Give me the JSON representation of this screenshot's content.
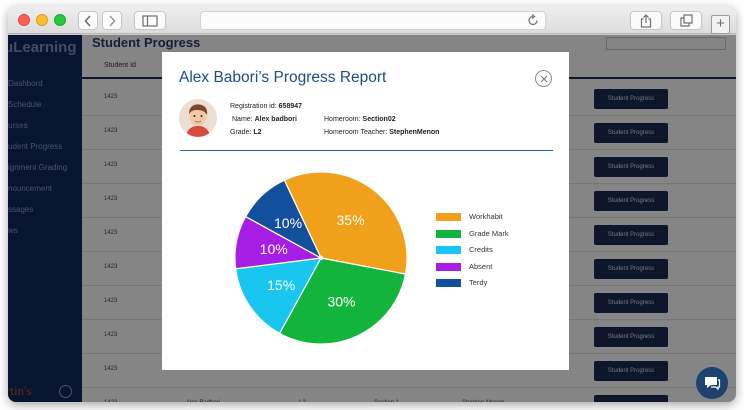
{
  "browser": {
    "nav_back": "back",
    "nav_forward": "forward"
  },
  "app": {
    "brand": "uLearning",
    "page_title": "Student Progress",
    "sidebar": {
      "items": [
        "Dashbord",
        "Schedule",
        "urses",
        "udent Progress",
        "ignment Grading",
        "nouncement",
        "ssages",
        "ws"
      ],
      "footer_logo": "rtin's"
    },
    "table": {
      "columns": [
        "Student Id"
      ],
      "rows": [
        {
          "id": "1423",
          "name": "",
          "grade": "",
          "section": "",
          "teacher": "",
          "action": "Student Progress"
        },
        {
          "id": "1423",
          "name": "",
          "grade": "",
          "section": "",
          "teacher": "",
          "action": "Student Progress"
        },
        {
          "id": "1423",
          "name": "",
          "grade": "",
          "section": "",
          "teacher": "",
          "action": "Student Progress"
        },
        {
          "id": "1423",
          "name": "",
          "grade": "",
          "section": "",
          "teacher": "",
          "action": "Student Progress"
        },
        {
          "id": "1423",
          "name": "",
          "grade": "",
          "section": "",
          "teacher": "",
          "action": "Student Progress"
        },
        {
          "id": "1423",
          "name": "",
          "grade": "",
          "section": "",
          "teacher": "",
          "action": "Student Progress"
        },
        {
          "id": "1423",
          "name": "",
          "grade": "",
          "section": "",
          "teacher": "",
          "action": "Student Progress"
        },
        {
          "id": "1423",
          "name": "",
          "grade": "",
          "section": "",
          "teacher": "",
          "action": "Student Progress"
        },
        {
          "id": "1423",
          "name": "",
          "grade": "",
          "section": "",
          "teacher": "",
          "action": "Student Progress"
        },
        {
          "id": "1423",
          "name": "Alex Badbori",
          "grade": "L2",
          "section": "Section 1",
          "teacher": "Stephen Menon",
          "action": "Student Progress"
        }
      ]
    }
  },
  "modal": {
    "title": "Alex Babori’s Progress Report",
    "registration_label": "Registration id:",
    "registration_value": "658947",
    "name_label": "Name:",
    "name_value": "Alex badbori",
    "grade_label": "Grade:",
    "grade_value": "L2",
    "homeroom_label": "Homeroom:",
    "homeroom_value": "Section02",
    "teacher_label": "Homeroom Teacher:",
    "teacher_value": "StephenMenon"
  },
  "chart_data": {
    "type": "pie",
    "categories": [
      "Workhabit",
      "Grade Mark",
      "Credits",
      "Absent",
      "Terdy"
    ],
    "values": [
      35,
      30,
      15,
      10,
      10
    ],
    "labels": [
      "35%",
      "30%",
      "15%",
      "10%",
      "10%"
    ],
    "colors": [
      "#f0a01a",
      "#12b43b",
      "#18c6f0",
      "#a61ee6",
      "#124f9c"
    ],
    "legend_position": "right"
  }
}
